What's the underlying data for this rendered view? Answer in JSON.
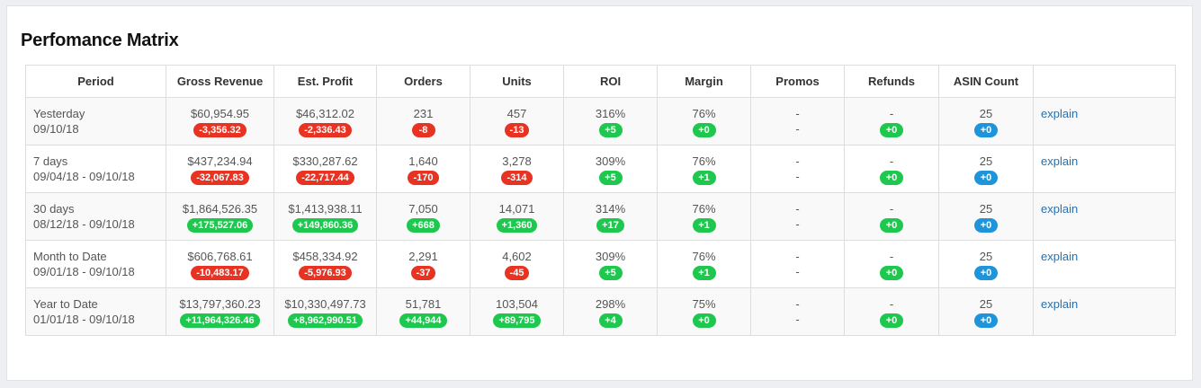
{
  "title": "Perfomance Matrix",
  "colors": {
    "negative": "#e83323",
    "positive": "#1ec74e",
    "info": "#1e94da",
    "link": "#2a6fa8"
  },
  "columns": [
    "Period",
    "Gross Revenue",
    "Est. Profit",
    "Orders",
    "Units",
    "ROI",
    "Margin",
    "Promos",
    "Refunds",
    "ASIN Count",
    ""
  ],
  "rows": [
    {
      "period": "Yesterday",
      "range": "09/10/18",
      "cells": [
        {
          "value": "$60,954.95",
          "delta": "-3,356.32",
          "tone": "neg"
        },
        {
          "value": "$46,312.02",
          "delta": "-2,336.43",
          "tone": "neg"
        },
        {
          "value": "231",
          "delta": "-8",
          "tone": "neg"
        },
        {
          "value": "457",
          "delta": "-13",
          "tone": "neg"
        },
        {
          "value": "316%",
          "delta": "+5",
          "tone": "pos"
        },
        {
          "value": "76%",
          "delta": "+0",
          "tone": "pos"
        },
        {
          "value": "-",
          "value2": "-"
        },
        {
          "value": "-",
          "delta": "+0",
          "tone": "pos"
        },
        {
          "value": "25",
          "delta": "+0",
          "tone": "info"
        }
      ],
      "action": "explain"
    },
    {
      "period": "7 days",
      "range": "09/04/18 - 09/10/18",
      "cells": [
        {
          "value": "$437,234.94",
          "delta": "-32,067.83",
          "tone": "neg"
        },
        {
          "value": "$330,287.62",
          "delta": "-22,717.44",
          "tone": "neg"
        },
        {
          "value": "1,640",
          "delta": "-170",
          "tone": "neg"
        },
        {
          "value": "3,278",
          "delta": "-314",
          "tone": "neg"
        },
        {
          "value": "309%",
          "delta": "+5",
          "tone": "pos"
        },
        {
          "value": "76%",
          "delta": "+1",
          "tone": "pos"
        },
        {
          "value": "-",
          "value2": "-"
        },
        {
          "value": "-",
          "delta": "+0",
          "tone": "pos"
        },
        {
          "value": "25",
          "delta": "+0",
          "tone": "info"
        }
      ],
      "action": "explain"
    },
    {
      "period": "30 days",
      "range": "08/12/18 - 09/10/18",
      "cells": [
        {
          "value": "$1,864,526.35",
          "delta": "+175,527.06",
          "tone": "pos"
        },
        {
          "value": "$1,413,938.11",
          "delta": "+149,860.36",
          "tone": "pos"
        },
        {
          "value": "7,050",
          "delta": "+668",
          "tone": "pos"
        },
        {
          "value": "14,071",
          "delta": "+1,360",
          "tone": "pos"
        },
        {
          "value": "314%",
          "delta": "+17",
          "tone": "pos"
        },
        {
          "value": "76%",
          "delta": "+1",
          "tone": "pos"
        },
        {
          "value": "-",
          "value2": "-"
        },
        {
          "value": "-",
          "delta": "+0",
          "tone": "pos"
        },
        {
          "value": "25",
          "delta": "+0",
          "tone": "info"
        }
      ],
      "action": "explain"
    },
    {
      "period": "Month to Date",
      "range": "09/01/18 - 09/10/18",
      "cells": [
        {
          "value": "$606,768.61",
          "delta": "-10,483.17",
          "tone": "neg"
        },
        {
          "value": "$458,334.92",
          "delta": "-5,976.93",
          "tone": "neg"
        },
        {
          "value": "2,291",
          "delta": "-37",
          "tone": "neg"
        },
        {
          "value": "4,602",
          "delta": "-45",
          "tone": "neg"
        },
        {
          "value": "309%",
          "delta": "+5",
          "tone": "pos"
        },
        {
          "value": "76%",
          "delta": "+1",
          "tone": "pos"
        },
        {
          "value": "-",
          "value2": "-"
        },
        {
          "value": "-",
          "delta": "+0",
          "tone": "pos"
        },
        {
          "value": "25",
          "delta": "+0",
          "tone": "info"
        }
      ],
      "action": "explain"
    },
    {
      "period": "Year to Date",
      "range": "01/01/18 - 09/10/18",
      "cells": [
        {
          "value": "$13,797,360.23",
          "delta": "+11,964,326.46",
          "tone": "pos"
        },
        {
          "value": "$10,330,497.73",
          "delta": "+8,962,990.51",
          "tone": "pos"
        },
        {
          "value": "51,781",
          "delta": "+44,944",
          "tone": "pos"
        },
        {
          "value": "103,504",
          "delta": "+89,795",
          "tone": "pos"
        },
        {
          "value": "298%",
          "delta": "+4",
          "tone": "pos"
        },
        {
          "value": "75%",
          "delta": "+0",
          "tone": "pos"
        },
        {
          "value": "-",
          "value2": "-"
        },
        {
          "value": "-",
          "delta": "+0",
          "tone": "pos"
        },
        {
          "value": "25",
          "delta": "+0",
          "tone": "info"
        }
      ],
      "action": "explain"
    }
  ]
}
